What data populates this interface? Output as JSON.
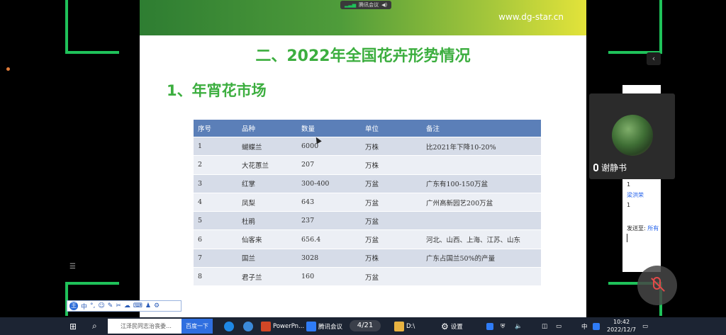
{
  "meeting": {
    "app_label": "腾讯会议"
  },
  "slide": {
    "url": "www.dg-star.cn",
    "title": "二、2022年全国花卉形势情况",
    "subtitle": "1、年宵花市场",
    "table": {
      "headers": [
        "序号",
        "品种",
        "数量",
        "单位",
        "备注"
      ],
      "rows": [
        [
          "1",
          "蝴蝶兰",
          "6000",
          "万株",
          "比2021年下降10-20%"
        ],
        [
          "2",
          "大花蕙兰",
          "207",
          "万株",
          ""
        ],
        [
          "3",
          "红掌",
          "300-400",
          "万盆",
          "广东有100-150万盆"
        ],
        [
          "4",
          "凤梨",
          "643",
          "万盆",
          "广州高新园艺200万盆"
        ],
        [
          "5",
          "杜鹃",
          "237",
          "万盆",
          ""
        ],
        [
          "6",
          "仙客来",
          "656.4",
          "万盆",
          "河北、山西、上海、江苏、山东"
        ],
        [
          "7",
          "国兰",
          "3028",
          "万株",
          "广东占国兰50%的产量"
        ],
        [
          "8",
          "君子兰",
          "160",
          "万盆",
          ""
        ]
      ]
    }
  },
  "participant": {
    "name": "谢静书"
  },
  "chat": {
    "lines": [
      "1",
      "梁洪荣",
      "1"
    ],
    "send_to_label": "发送至:",
    "send_to_target": "所有"
  },
  "ime": {
    "logo": "王",
    "mode": "中"
  },
  "taskbar": {
    "search_placeholder": "江泽民同志治丧委…",
    "search_button": "百度一下",
    "powerpoint_label": "PowerPn...",
    "meeting_label": "腾讯会议",
    "page_indicator": "4/21",
    "explorer_label": "D:\\",
    "settings_label": "设置",
    "ime_tray": "中",
    "time": "10:42",
    "date": "2022/12/7"
  },
  "colors": {
    "bracket": "#1fc25a",
    "slide_title": "#3cae3f",
    "table_header": "#5b7fb8"
  }
}
